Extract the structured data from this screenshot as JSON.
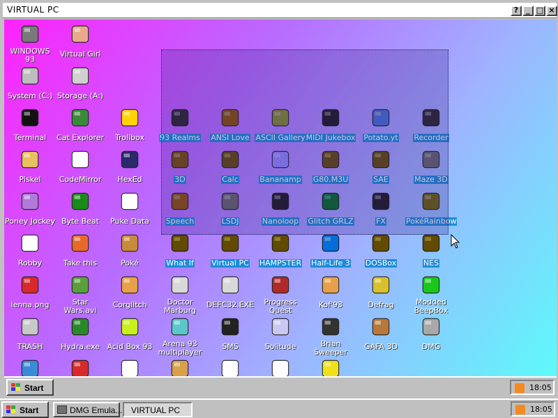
{
  "window": {
    "title": "VIRTUAL PC",
    "buttons": {
      "help": "?",
      "minimize": "_",
      "maximize": "□",
      "close": "×"
    }
  },
  "desktop_icons": [
    {
      "label": "WINDOWS 93",
      "icon": "computer-icon",
      "color": "#7a7a7a"
    },
    {
      "label": "Virtual Girl",
      "icon": "face-icon",
      "color": "#e9a98a"
    },
    {
      "label": "System (C:)",
      "icon": "drive-icon",
      "color": "#bdbdbd"
    },
    {
      "label": "Storage (A:)",
      "icon": "floppy-drive-icon",
      "color": "#d0d0d0"
    },
    {
      "label": "Terminal",
      "icon": "terminal-icon",
      "color": "#111111"
    },
    {
      "label": "Cat Explorer",
      "icon": "cat-globe-icon",
      "color": "#3a8a3a"
    },
    {
      "label": "Trollbox",
      "icon": "smiley-chat-icon",
      "color": "#ffd400"
    },
    {
      "label": "93 Realms",
      "icon": "knight-icon",
      "color": "#333333",
      "selected": true
    },
    {
      "label": "ANSI Love",
      "icon": "pen-letter-icon",
      "color": "#2a7ad8",
      "selected": true
    },
    {
      "label": "ASCII Gallery",
      "icon": "ascii-icon",
      "color": "#9aa9ff",
      "selected": true
    },
    {
      "label": "MIDI Jukebox",
      "icon": "piano-icon",
      "color": "#222222",
      "selected": true
    },
    {
      "label": "Potato.yt",
      "icon": "potato-icon",
      "color": "#c98a3a",
      "selected": true
    },
    {
      "label": "Recorder",
      "icon": "microphone-icon",
      "color": "#333333",
      "selected": true
    },
    {
      "label": "Piskel",
      "icon": "palette-icon",
      "color": "#e8c060"
    },
    {
      "label": "CodeMirror",
      "icon": "cat-code-icon",
      "color": "#ffffff"
    },
    {
      "label": "HexEd",
      "icon": "hexagon-icon",
      "color": "#2a2a6a"
    },
    {
      "label": "3D",
      "icon": "teapot-icon",
      "color": "#2b6fd6",
      "selected": true
    },
    {
      "label": "Calc",
      "icon": "calculator-icon",
      "color": "#2b5fd6",
      "selected": true
    },
    {
      "label": "Bananamp",
      "icon": "banana-icon",
      "color": "#f2d21a",
      "selected": true
    },
    {
      "label": "G80.M3U",
      "icon": "speaker-icon",
      "color": "#2b5fd6",
      "selected": true
    },
    {
      "label": "SAE",
      "icon": "ball-icon",
      "color": "#2b5fd6",
      "selected": true
    },
    {
      "label": "Maze 3D",
      "icon": "maze-icon",
      "color": "#888888",
      "selected": true
    },
    {
      "label": "Poney Jockey",
      "icon": "pony-icon",
      "color": "#b07ad8"
    },
    {
      "label": "Byte Beat",
      "icon": "bytebeat-icon",
      "color": "#1a8a1a"
    },
    {
      "label": "Puke Data",
      "icon": "pd-icon",
      "color": "#ffffff"
    },
    {
      "label": "Speech",
      "icon": "face-speech-icon",
      "color": "#2b7fd6",
      "selected": true
    },
    {
      "label": "LSDJ",
      "icon": "gameboy-icon",
      "color": "#888888",
      "selected": true
    },
    {
      "label": "Nanoloop",
      "icon": "wave-icon",
      "color": "#222222",
      "selected": true
    },
    {
      "label": "Glitch GRLZ",
      "icon": "lips-icon",
      "color": "#d82a8a",
      "selected": true
    },
    {
      "label": "FX",
      "icon": "flower-icon",
      "color": "#222222",
      "selected": true
    },
    {
      "label": "PokéRainbow",
      "icon": "poke-icon",
      "color": "#5a7ad8",
      "selected": true
    },
    {
      "label": "Robby",
      "icon": "stickman-icon",
      "color": "#ffffff"
    },
    {
      "label": "Take this",
      "icon": "pixel-guy-icon",
      "color": "#e86a2a"
    },
    {
      "label": "Poké",
      "icon": "poke-ball-icon",
      "color": "#c98a3a"
    },
    {
      "label": "What If",
      "icon": "window-icon",
      "color": "#2b5fd6",
      "selected": true
    },
    {
      "label": "Virtual PC",
      "icon": "pc-window-icon",
      "color": "#2b5fd6",
      "selected": true
    },
    {
      "label": "HAMPSTER",
      "icon": "hamster-icon",
      "color": "#2b5fd6",
      "selected": true
    },
    {
      "label": "Half-Life 3",
      "icon": "lambda-icon",
      "color": "#e86a1a",
      "selected": true
    },
    {
      "label": "DOSBox",
      "icon": "dosbox-icon",
      "color": "#2b5fd6",
      "selected": true
    },
    {
      "label": "NES",
      "icon": "nes-icon",
      "color": "#2b5fd6",
      "selected": true
    },
    {
      "label": "lenna.png",
      "icon": "image-file-icon",
      "color": "#d82a2a"
    },
    {
      "label": "Star Wars.avi",
      "icon": "yoda-icon",
      "color": "#5aa03a"
    },
    {
      "label": "Corglitch",
      "icon": "corgi-icon",
      "color": "#e8a04a"
    },
    {
      "label": "Doctor Marburg",
      "icon": "doctor-icon",
      "color": "#d8d8d8"
    },
    {
      "label": "DEFC32.EXE",
      "icon": "monitor-face-icon",
      "color": "#d8d8d8"
    },
    {
      "label": "Progress Quest",
      "icon": "swords-icon",
      "color": "#b02a2a"
    },
    {
      "label": "Kof'93",
      "icon": "fighter-icon",
      "color": "#e8a04a"
    },
    {
      "label": "Defrag",
      "icon": "defrag-icon",
      "color": "#d8c02a"
    },
    {
      "label": "Modded BeepBox",
      "icon": "beepbox-icon",
      "color": "#1ac81a"
    },
    {
      "label": "TRASH",
      "icon": "trash-icon",
      "color": "#c8c8c8"
    },
    {
      "label": "Hydra.exe",
      "icon": "hydra-icon",
      "color": "#2a8a2a"
    },
    {
      "label": "Acid Box 93",
      "icon": "acid-smiley-icon",
      "color": "#c8f01a"
    },
    {
      "label": "Arena 93 multiplayer",
      "icon": "cube-icon",
      "color": "#5ac8c8"
    },
    {
      "label": "SMS",
      "icon": "sms-console-icon",
      "color": "#222222"
    },
    {
      "label": "Solitude",
      "icon": "bottle-icon",
      "color": "#c8c8f0"
    },
    {
      "label": "Brian Sweeper",
      "icon": "mine-icon",
      "color": "#333333"
    },
    {
      "label": "GAFA 3D",
      "icon": "doom-guy-icon",
      "color": "#b8783a"
    },
    {
      "label": "DMG",
      "icon": "cartridge-icon",
      "color": "#a8a8a8"
    },
    {
      "label": "",
      "icon": "dolphin-icon",
      "color": "#3a8ad8"
    },
    {
      "label": "",
      "icon": "image-file-icon",
      "color": "#d82a2a"
    },
    {
      "label": "",
      "icon": "book-icon",
      "color": "#ffffff"
    },
    {
      "label": "",
      "icon": "cookie-icon",
      "color": "#d8a04a"
    },
    {
      "label": "",
      "icon": "notepad-icon",
      "color": "#ffffff"
    },
    {
      "label": "",
      "icon": "document-icon",
      "color": "#ffffff"
    },
    {
      "label": "",
      "icon": "question-icon",
      "color": "#f0e01a"
    }
  ],
  "inner_taskbar": {
    "start_label": "Start",
    "clock": "18:05"
  },
  "outer_taskbar": {
    "start_label": "Start",
    "tasks": [
      {
        "label": "DMG Emula..."
      },
      {
        "label": "VIRTUAL PC"
      }
    ],
    "clock": "18:05"
  }
}
